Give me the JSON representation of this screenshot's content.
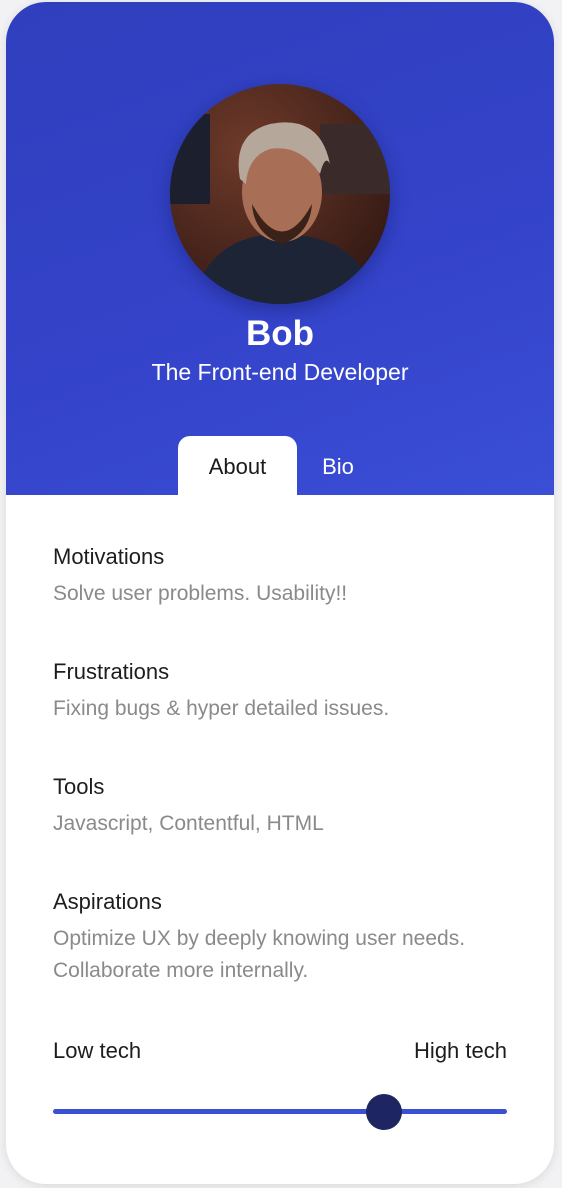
{
  "profile": {
    "name": "Bob",
    "role": "The Front-end Developer"
  },
  "avatar": {
    "icon": "portrait-photo"
  },
  "tabs": [
    {
      "label": "About",
      "active": true
    },
    {
      "label": "Bio",
      "active": false
    }
  ],
  "sections": [
    {
      "title": "Motivations",
      "text": "Solve user problems. Usability!!"
    },
    {
      "title": "Frustrations",
      "text": "Fixing bugs & hyper detailed issues."
    },
    {
      "title": "Tools",
      "text": "Javascript, Contentful, HTML"
    },
    {
      "title": "Aspirations",
      "text": "Optimize UX by deeply knowing user needs. Collaborate more internally."
    }
  ],
  "tech_slider": {
    "low_label": "Low tech",
    "high_label": "High tech",
    "value": 0.73
  },
  "colors": {
    "header": "#3443c9",
    "track": "#3b4fd3",
    "thumb": "#1d2563"
  }
}
